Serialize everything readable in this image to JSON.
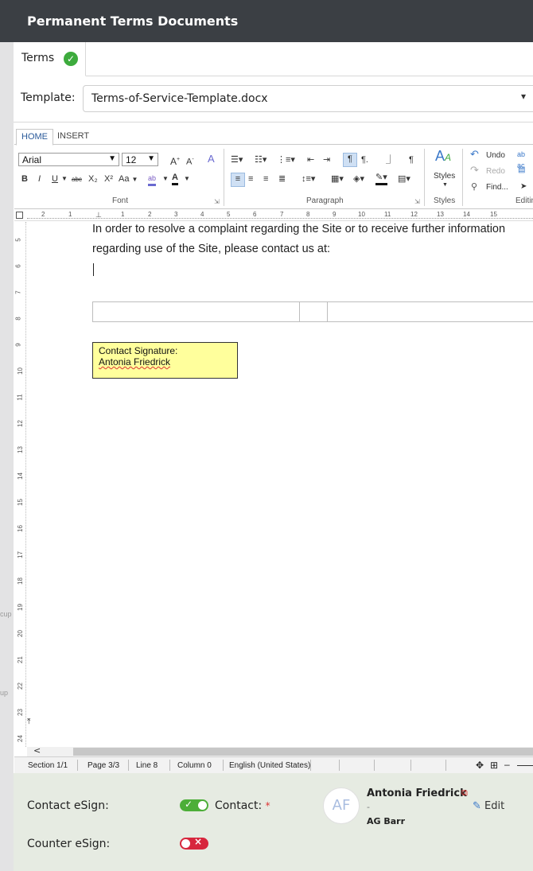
{
  "dialog": {
    "title": "Permanent Terms Documents"
  },
  "tabs": [
    {
      "label": "Terms",
      "status": "complete"
    }
  ],
  "template": {
    "label": "Template:",
    "value": "Terms-of-Service-Template.docx"
  },
  "ribbon": {
    "tabs": [
      "HOME",
      "INSERT"
    ],
    "font_name": "Arial",
    "font_size": "12",
    "groups": {
      "font": "Font",
      "paragraph": "Paragraph",
      "styles": "Styles",
      "editing": "Editin"
    },
    "styles_label": "Styles",
    "undo": "Undo",
    "redo": "Redo",
    "find": "Find...",
    "case_label": "Aa",
    "bold": "B",
    "italic": "I",
    "underline": "U",
    "strike": "abc",
    "subscript": "X₂",
    "superscript": "X²"
  },
  "document": {
    "lines": [
      "In order to resolve a complaint regarding the Site or to receive further information",
      "regarding use of the Site, please contact us at:"
    ],
    "signature_block": {
      "heading": "Contact Signature:",
      "name": "Antonia Friedrick"
    }
  },
  "ruler": {
    "marks": [
      "2",
      "1",
      "1",
      "2",
      "3",
      "4",
      "5",
      "6",
      "7",
      "8",
      "9",
      "10",
      "11",
      "12",
      "13",
      "14",
      "15"
    ]
  },
  "vruler": {
    "marks": [
      "5",
      "6",
      "7",
      "8",
      "9",
      "10",
      "11",
      "12",
      "13",
      "14",
      "15",
      "16",
      "17",
      "18",
      "19",
      "20",
      "21",
      "22",
      "23",
      "24"
    ]
  },
  "statusbar": {
    "section": "Section 1/1",
    "page": "Page 3/3",
    "line": "Line 8",
    "column": "Column 0",
    "language": "English (United States)"
  },
  "esign": {
    "contact_label": "Contact eSign:",
    "contact_enabled": true,
    "counter_label": "Counter eSign:",
    "counter_enabled": false,
    "contact_field_label": "Contact:",
    "required_mark": "*",
    "avatar_initials": "AF",
    "contact_name": "Antonia Friedrick",
    "contact_dash": "-",
    "contact_org": "AG Barr",
    "edit_label": "Edit"
  },
  "backdrop": {
    "fragments": [
      "cup",
      "up"
    ]
  },
  "colors": {
    "header_bg": "#3b3f44",
    "accent_green": "#4cae38",
    "danger_red": "#d7263d",
    "signature_yellow": "#ffff9c",
    "footer_bg": "#e6ebe2"
  }
}
